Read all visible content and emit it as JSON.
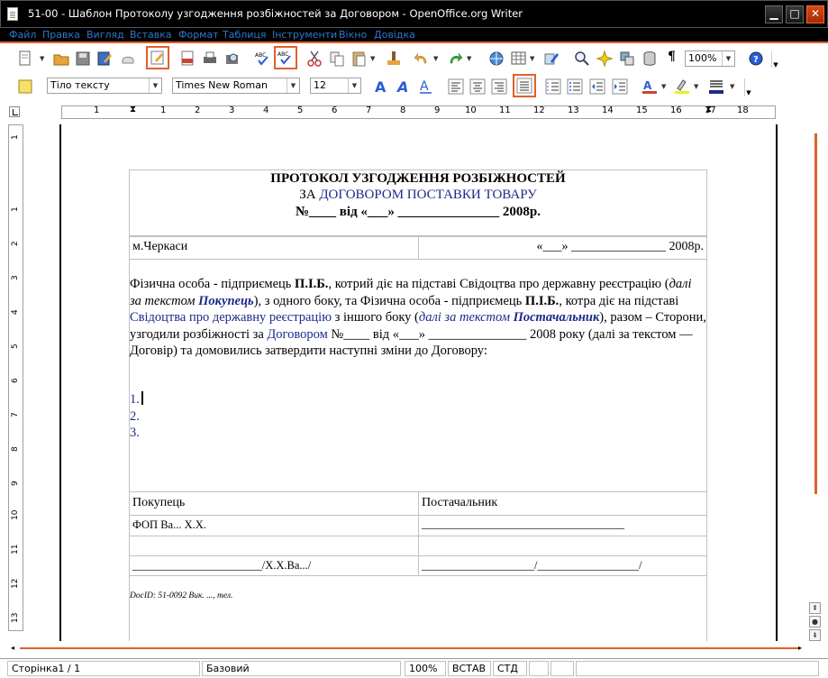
{
  "window": {
    "title": "51-00 - Шаблон Протоколу узгодження розбіжностей за Договором - OpenOffice.org Writer",
    "minimize": "▁",
    "maximize": "□",
    "close": "✕"
  },
  "menu": [
    "Файл",
    "Правка",
    "Вигляд",
    "Вставка",
    "Формат",
    "Таблиця",
    "Інструменти",
    "Вікно",
    "Довідка"
  ],
  "toolbar": {
    "zoom": "100%",
    "paragraph_style": "Тіло тексту",
    "font_name": "Times New Roman",
    "font_size": "12",
    "pilcrow": "¶"
  },
  "ruler": {
    "h_labels": [
      "1",
      "1",
      "2",
      "3",
      "4",
      "5",
      "6",
      "7",
      "8",
      "9",
      "10",
      "11",
      "12",
      "13",
      "14",
      "15",
      "16",
      "17",
      "18"
    ],
    "v_labels": [
      "1",
      "1",
      "2",
      "3",
      "4",
      "5",
      "6",
      "7",
      "8",
      "9",
      "10",
      "11",
      "12",
      "13"
    ]
  },
  "document": {
    "heading1": "ПРОТОКОЛ УЗГОДЖЕННЯ РОЗБІЖНОСТЕЙ",
    "heading2_prefix": "ЗА ",
    "heading2_link": "ДОГОВОРОМ ПОСТАВКИ ТОВАРУ",
    "heading3": "№____  від «___» _______________ 2008р.",
    "city": "м.Черкаси",
    "date": "«___» _______________ 2008р.",
    "para": {
      "p1": "Фізична особа - підприємець ",
      "p2": "П.І.Б.",
      "p3": ", котрий діє на підставі Свідоцтва про державну реєстрацію (",
      "p4": "далі за текстом ",
      "p5": "Покупець",
      "p6": "), з одного боку, та Фізична особа - підприємець ",
      "p7": "П.І.Б.",
      "p8": ", котра діє на підставі ",
      "p9": "Свідоцтва про державну реєстрацію",
      "p10": " з іншого боку (",
      "p11": "далі за текстом ",
      "p12": "Постачальник",
      "p13": "), разом – Сторони, узгодили розбіжності за ",
      "p14": "Договором",
      "p15": " №____ від «___» _______________ 2008 року (далі за текстом — Договір) та домовились затвердити наступні зміни до Договору:"
    },
    "list": [
      "1.",
      "2.",
      "3."
    ],
    "sign_table": {
      "buyer": "Покупець",
      "supplier": "Постачальник",
      "buyer_name": "ФОП Ва... Х.Х.",
      "supplier_line": "____________________________________",
      "buyer_sign": "_______________________/Х.Х.Ва.../",
      "supplier_sign": "____________________/__________________/"
    },
    "docid": "DocID: 51-0092 Вик. ..., тел."
  },
  "status": {
    "page": "Сторінка1 / 1",
    "style": "Базовий",
    "zoom": "100%",
    "insert": "ВСТАВ",
    "std": "СТД"
  },
  "colors": {
    "accent": "#e0602c",
    "menu_text": "#2d78c8",
    "link_blue": "#1a2a8a"
  }
}
